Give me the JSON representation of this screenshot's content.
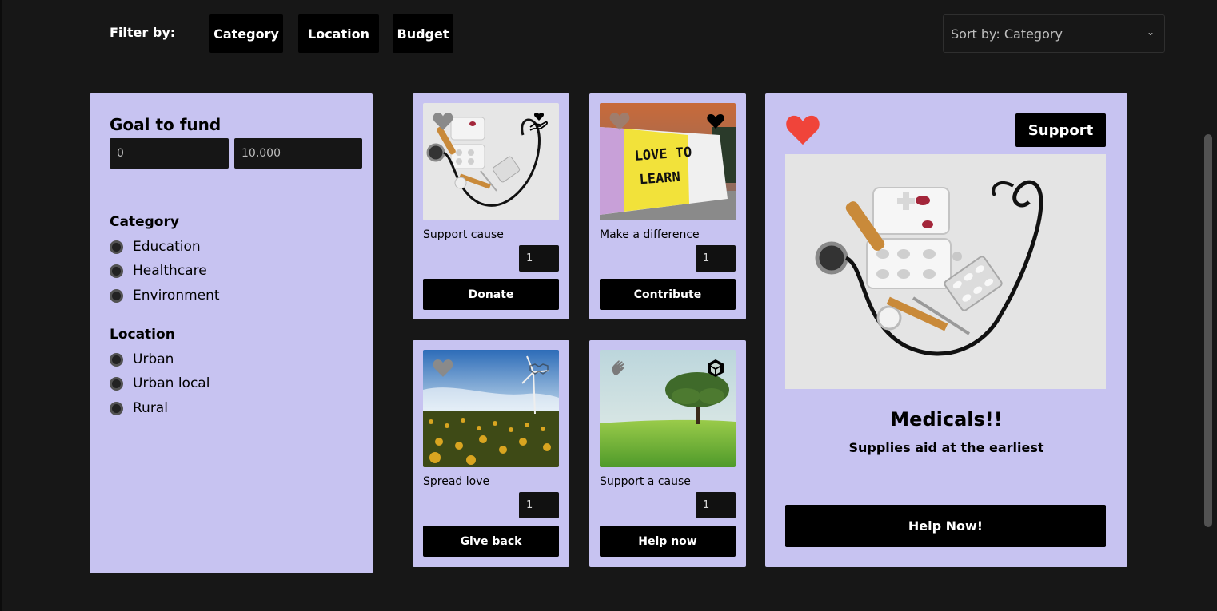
{
  "filter": {
    "label": "Filter by:",
    "buttons": [
      "Category",
      "Location",
      "Budget"
    ]
  },
  "sort": {
    "label": "Sort by: Category",
    "icon": "chevron-down-icon"
  },
  "sidebar": {
    "goal_title": "Goal to fund",
    "min_value": "0",
    "max_value": "10,000",
    "category_title": "Category",
    "categories": [
      "Education",
      "Healthcare",
      "Environment"
    ],
    "location_title": "Location",
    "locations": [
      "Urban",
      "Urban local",
      "Rural"
    ]
  },
  "cards": [
    {
      "caption": "Support cause",
      "qty": "1",
      "action": "Donate",
      "image": "medical-supplies-photo",
      "corner_icon": "hand-heart-icon"
    },
    {
      "caption": "Make a difference",
      "qty": "1",
      "action": "Contribute",
      "image": "love-to-learn-pencil-photo",
      "corner_icon": "heart-icon"
    },
    {
      "caption": "Spread love",
      "qty": "1",
      "action": "Give back",
      "image": "sunflower-wind-turbine-photo",
      "corner_icon": "handshake-icon"
    },
    {
      "caption": "Support a cause",
      "qty": "1",
      "action": "Help now",
      "image": "tree-field-photo",
      "corner_icon": "unity-logo-icon"
    }
  ],
  "feature": {
    "support_label": "Support",
    "title": "Medicals!!",
    "subtitle": "Supplies aid at the earliest",
    "help_label": "Help Now!",
    "image": "medical-supplies-photo"
  },
  "colors": {
    "background": "#171717",
    "panel": "#c7c3f1",
    "button": "#000000",
    "heart_active": "#f0443a",
    "heart_inactive": "#8a8a8a"
  }
}
